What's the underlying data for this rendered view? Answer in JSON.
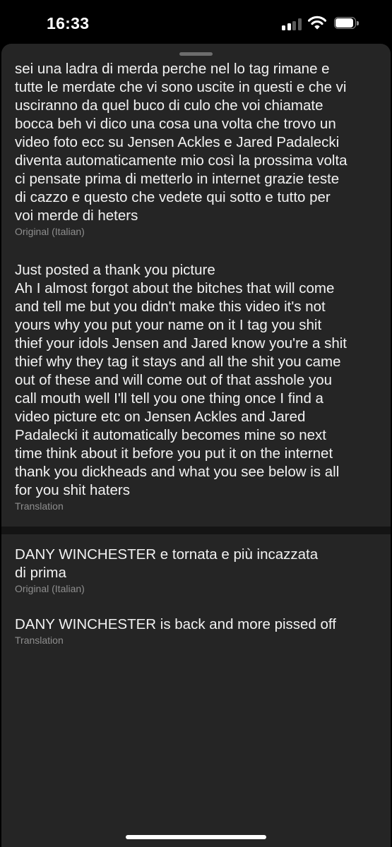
{
  "status_bar": {
    "time": "16:33",
    "signal_bars_active": 2,
    "signal_bars_total": 4
  },
  "sheet": {
    "original_1": {
      "text": "sei una ladra di merda perche nel lo tag rimane e\ntutte le merdate che vi sono uscite in questi e che vi\nusciranno da quel buco di culo che voi chiamate\nbocca beh vi dico una cosa una volta che trovo un\nvideo foto ecc su Jensen Ackles e Jared Padalecki\ndiventa automaticamente mio così la prossima volta\nci pensate prima di metterlo in internet grazie teste\ndi cazzo e questo che vedete qui sotto e tutto per\nvoi merde di heters",
      "label": "Original (Italian)"
    },
    "translation_1": {
      "text": "Just posted a thank you picture\nAh I almost forgot about the bitches that will come\nand tell me but you didn't make this video it's not\nyours why you put your name on it I tag you shit\nthief your idols Jensen and Jared know you're a shit\nthief why they tag it stays and all the shit you came\nout of these and will come out of that asshole you\ncall mouth well I'll tell you one thing once I find a\nvideo picture etc on Jensen Ackles and Jared\nPadalecki it automatically becomes mine so next\ntime think about it before you put it on the internet\nthank you dickheads and what you see below is all\nfor you shit haters",
      "label": "Translation"
    },
    "original_2": {
      "text": "DANY WINCHESTER e tornata e più incazzata\ndi prima",
      "label": "Original (Italian)"
    },
    "translation_2": {
      "text": "DANY WINCHESTER is back and more pissed off",
      "label": "Translation"
    }
  },
  "colors": {
    "screen_background": "#000000",
    "sheet_background": "#252525",
    "divider": "#141414",
    "body_text": "#f2f2f2",
    "caption_text": "#8e8e8e"
  },
  "icons": [
    "signal-icon",
    "wifi-icon",
    "battery-icon"
  ]
}
